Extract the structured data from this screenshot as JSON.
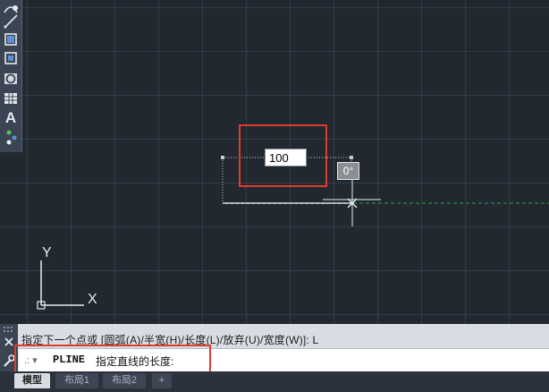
{
  "toolbar": {
    "items": [
      {
        "icon": "arc-icon"
      },
      {
        "icon": "line-icon"
      },
      {
        "icon": "rectangle-select-icon"
      },
      {
        "icon": "rectangle-icon"
      },
      {
        "icon": "circle-icon"
      },
      {
        "icon": "table-icon"
      },
      {
        "icon": "text-icon",
        "label": "A"
      },
      {
        "icon": "point-icon"
      }
    ]
  },
  "dynamic_input": {
    "length_value": "100",
    "angle_value": "0°"
  },
  "ucs": {
    "x_label": "X",
    "y_label": "Y"
  },
  "command": {
    "history": "指定下一个点或 [圆弧(A)/半宽(H)/长度(L)/放弃(U)/宽度(W)]: L",
    "prefix": ".: ▾",
    "name": "PLINE",
    "prompt": "指定直线的长度:"
  },
  "tabs": [
    {
      "label": "模型",
      "active": true
    },
    {
      "label": "布局1",
      "active": false
    },
    {
      "label": "布局2",
      "active": false
    },
    {
      "label": "+",
      "active": false
    }
  ],
  "colors": {
    "canvas_bg": "#212830",
    "highlight": "#e03b2e",
    "tracking": "#2ea043"
  }
}
